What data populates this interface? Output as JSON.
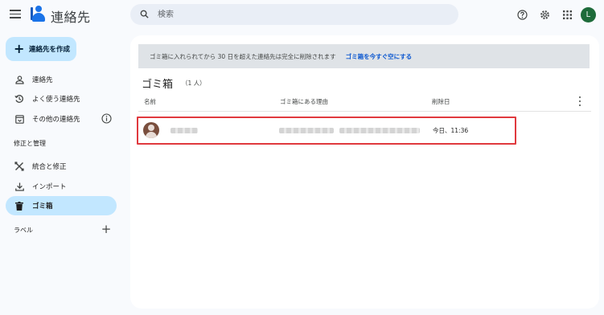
{
  "header": {
    "app_title": "連絡先",
    "search_placeholder": "検索",
    "avatar_initial": "L"
  },
  "sidebar": {
    "create_label": "連絡先を作成",
    "items": [
      {
        "label": "連絡先",
        "icon": "person-icon"
      },
      {
        "label": "よく使う連絡先",
        "icon": "history-icon"
      },
      {
        "label": "その他の連絡先",
        "icon": "archive-contact-icon"
      }
    ],
    "section_manage": "修正と管理",
    "manage_items": [
      {
        "label": "統合と修正",
        "icon": "tools-icon"
      },
      {
        "label": "インポート",
        "icon": "download-icon"
      },
      {
        "label": "ゴミ箱",
        "icon": "trash-icon"
      }
    ],
    "section_labels": "ラベル"
  },
  "main": {
    "banner_message": "ゴミ箱に入れられてから 30 日を超えた連絡先は完全に削除されます",
    "banner_link": "ゴミ箱を今すぐ空にする",
    "title": "ゴミ箱",
    "count": "（1 人）",
    "columns": {
      "name": "名前",
      "reason": "ゴミ箱にある理由",
      "deleted_date": "削除日"
    },
    "rows": [
      {
        "deleted_date": "今日、11:36"
      }
    ]
  },
  "colors": {
    "accent": "#1a73e8",
    "active_bg": "#c2e7ff",
    "highlight_border": "#e0393e",
    "banner_bg": "#dfe3e7",
    "link": "#0b57d0"
  }
}
